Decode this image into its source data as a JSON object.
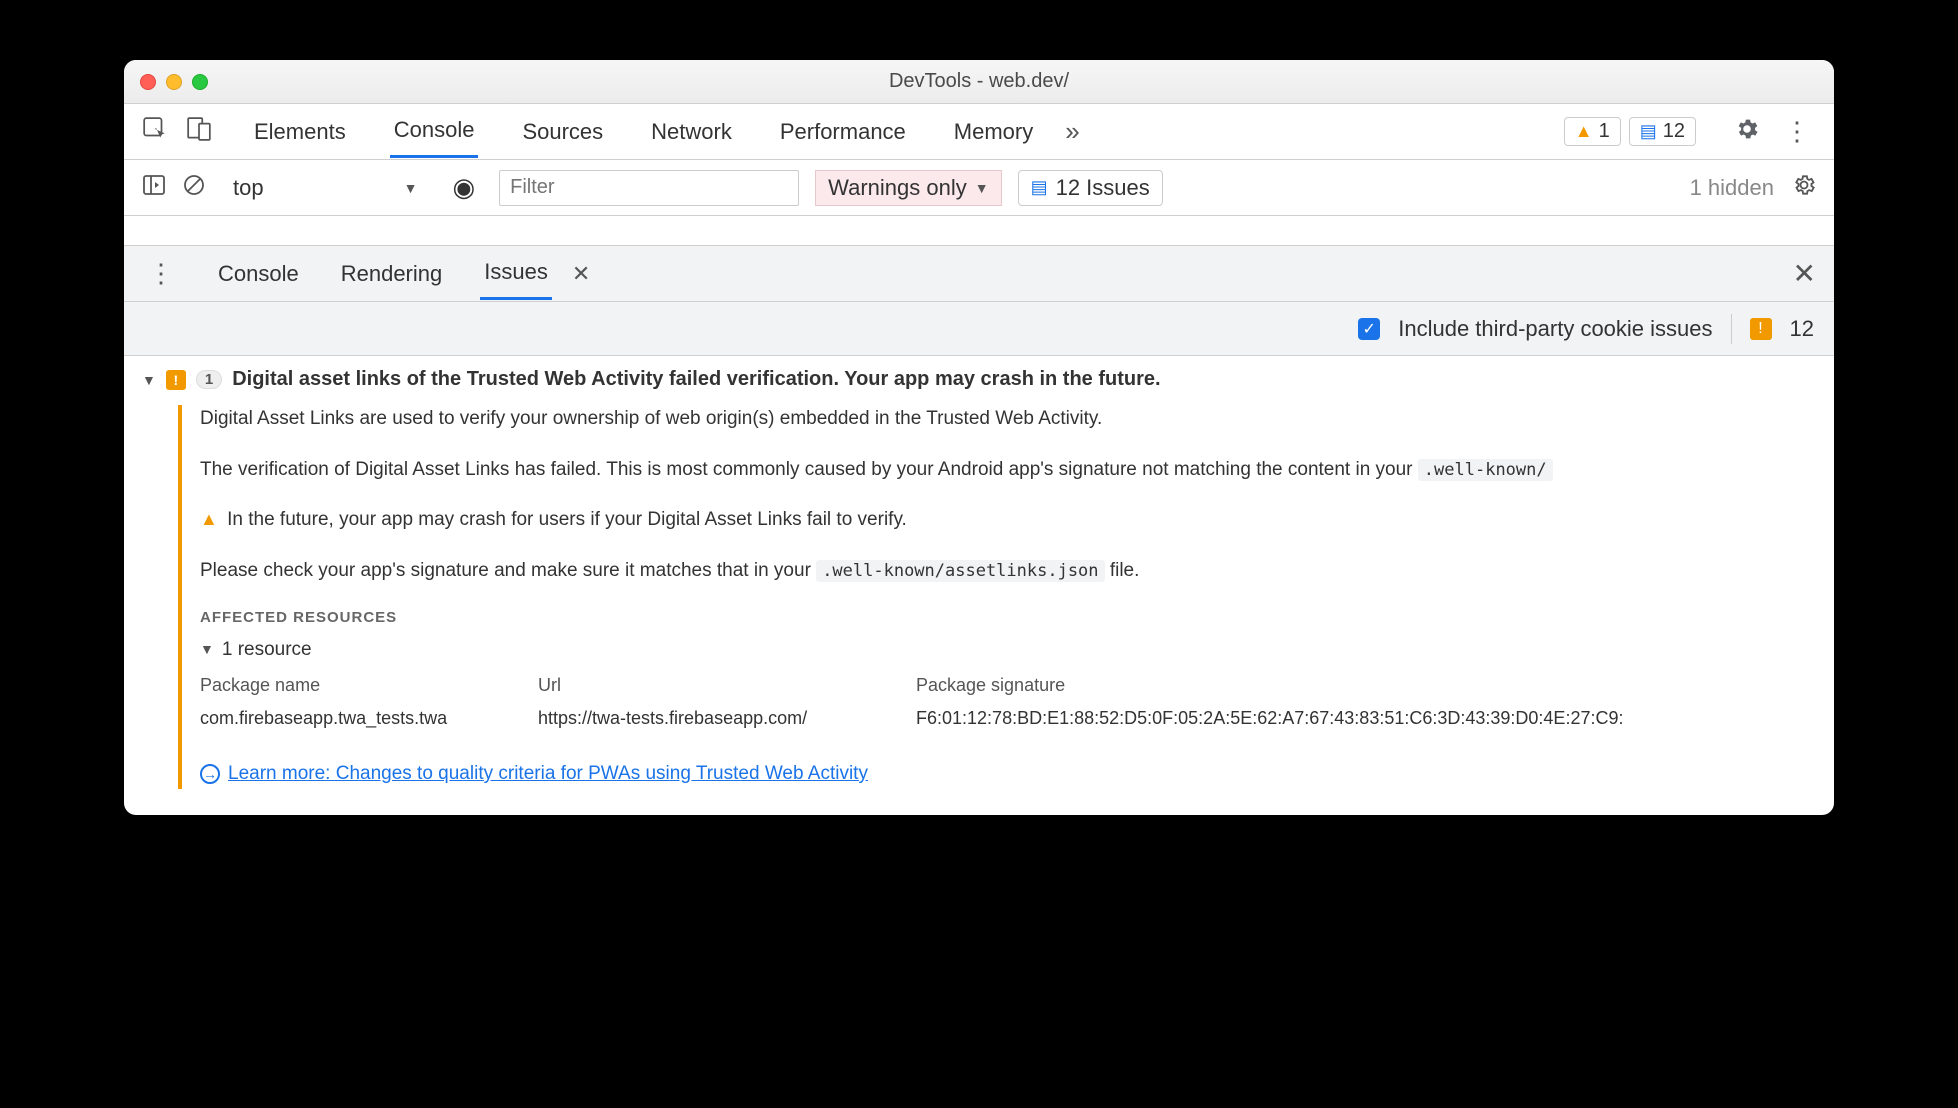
{
  "window": {
    "title": "DevTools - web.dev/"
  },
  "toolbar": {
    "tabs": [
      "Elements",
      "Console",
      "Sources",
      "Network",
      "Performance",
      "Memory"
    ],
    "active_tab": 1,
    "warning_count": "1",
    "issue_count": "12"
  },
  "filterbar": {
    "context": "top",
    "filter_placeholder": "Filter",
    "level": "Warnings only",
    "issues_label": "12 Issues",
    "hidden": "1 hidden"
  },
  "drawer": {
    "tabs": [
      "Console",
      "Rendering",
      "Issues"
    ],
    "active_tab": 2,
    "include_label": "Include third-party cookie issues",
    "issue_count": "12"
  },
  "issue": {
    "count_badge": "1",
    "title": "Digital asset links of the Trusted Web Activity failed verification. Your app may crash in the future.",
    "p1": "Digital Asset Links are used to verify your ownership of web origin(s) embedded in the Trusted Web Activity.",
    "p2a": "The verification of Digital Asset Links has failed. This is most commonly caused by your Android app's signature not matching the content in your ",
    "p2_code": ".well-known/",
    "p3": "In the future, your app may crash for users if your Digital Asset Links fail to verify.",
    "p4a": "Please check your app's signature and make sure it matches that in your ",
    "p4_code": ".well-known/assetlinks.json",
    "p4b": " file.",
    "affected_header": "Affected Resources",
    "resource_summary": "1 resource",
    "table": {
      "headers": [
        "Package name",
        "Url",
        "Package signature"
      ],
      "row": {
        "package": "com.firebaseapp.twa_tests.twa",
        "url": "https://twa-tests.firebaseapp.com/",
        "signature": "F6:01:12:78:BD:E1:88:52:D5:0F:05:2A:5E:62:A7:67:43:83:51:C6:3D:43:39:D0:4E:27:C9:"
      }
    },
    "learn_more": "Learn more: Changes to quality criteria for PWAs using Trusted Web Activity"
  }
}
